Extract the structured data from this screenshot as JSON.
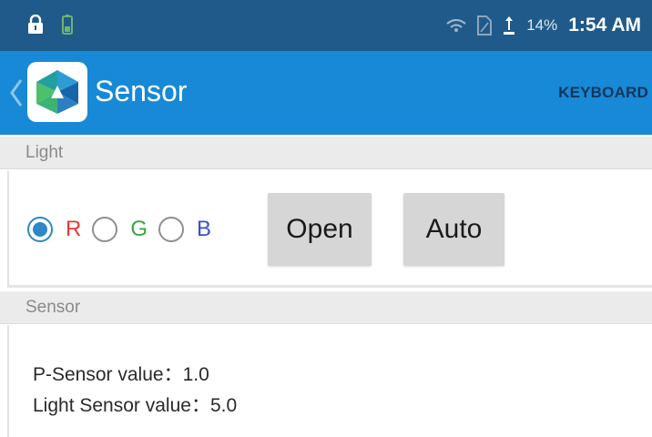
{
  "status_bar": {
    "battery_percent": "14%",
    "time": "1:54 AM",
    "icons": [
      "lock-icon",
      "battery-small-icon",
      "wifi-icon",
      "sim-icon",
      "usb-icon"
    ]
  },
  "app_bar": {
    "title": "Sensor",
    "action": "KEYBOARD",
    "icons": [
      "chevron-left-icon",
      "app-logo-icon"
    ],
    "color": "#1789d6"
  },
  "light_section": {
    "header": "Light",
    "radios": [
      {
        "label": "R",
        "checked": true,
        "color": "#e53935"
      },
      {
        "label": "G",
        "checked": false,
        "color": "#3aa542"
      },
      {
        "label": "B",
        "checked": false,
        "color": "#3a4fd1"
      }
    ],
    "buttons": {
      "open": "Open",
      "auto": "Auto"
    }
  },
  "sensor_section": {
    "header": "Sensor",
    "p_sensor_label": "P-Sensor value：",
    "p_sensor_value": "1.0",
    "light_sensor_label": "Light Sensor value：",
    "light_sensor_value": "5.0"
  }
}
